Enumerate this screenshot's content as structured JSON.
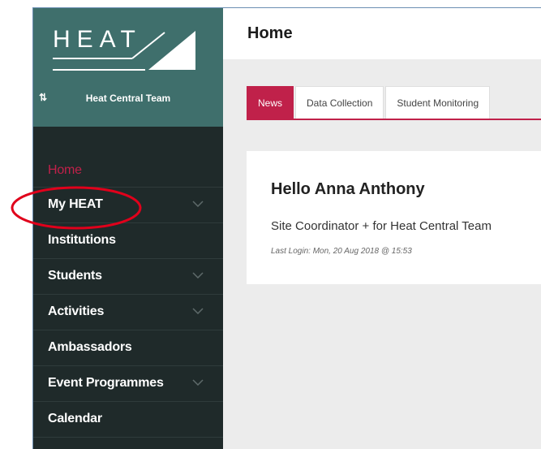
{
  "brand": {
    "logo_text": "HEAT",
    "team_name": "Heat Central Team",
    "switch_icon": "⇅"
  },
  "nav": {
    "items": [
      {
        "label": "Home",
        "active": true,
        "has_children": false
      },
      {
        "label": "My HEAT",
        "active": false,
        "has_children": true
      },
      {
        "label": "Institutions",
        "active": false,
        "has_children": false
      },
      {
        "label": "Students",
        "active": false,
        "has_children": true
      },
      {
        "label": "Activities",
        "active": false,
        "has_children": true
      },
      {
        "label": "Ambassadors",
        "active": false,
        "has_children": false
      },
      {
        "label": "Event Programmes",
        "active": false,
        "has_children": true
      },
      {
        "label": "Calendar",
        "active": false,
        "has_children": false
      }
    ]
  },
  "header": {
    "title": "Home"
  },
  "tabs": [
    {
      "label": "News",
      "active": true
    },
    {
      "label": "Data Collection",
      "active": false
    },
    {
      "label": "Student Monitoring",
      "active": false
    }
  ],
  "welcome": {
    "greeting": "Hello Anna Anthony",
    "role": "Site Coordinator + for Heat Central Team",
    "last_login": "Last Login: Mon, 20 Aug 2018 @ 15:53"
  },
  "colors": {
    "sidebar_bg": "#1f2a2a",
    "brand_bg": "#3f6f6c",
    "accent": "#c0214a",
    "annotation": "#e0001b"
  }
}
